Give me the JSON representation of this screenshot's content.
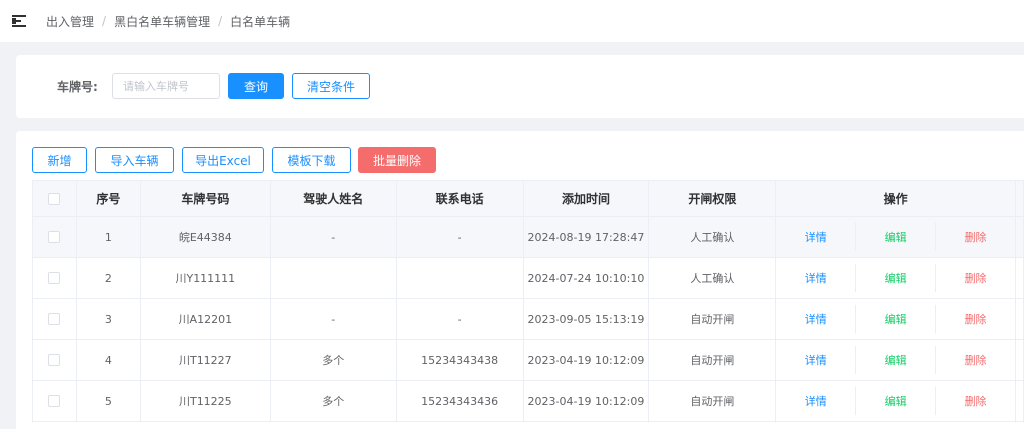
{
  "breadcrumb": [
    "出入管理",
    "黑白名单车辆管理",
    "白名单车辆"
  ],
  "search": {
    "label": "车牌号:",
    "placeholder": "请输入车牌号",
    "query_button": "查询",
    "clear_button": "清空条件"
  },
  "toolbar": {
    "add": "新增",
    "import": "导入车辆",
    "export": "导出Excel",
    "template": "模板下载",
    "batch_delete": "批量删除"
  },
  "table": {
    "columns": [
      "序号",
      "车牌号码",
      "驾驶人姓名",
      "联系电话",
      "添加时间",
      "开闸权限",
      "操作"
    ],
    "rows": [
      {
        "idx": "1",
        "plate": "皖E44384",
        "driver": "-",
        "phone": "-",
        "time": "2024-08-19 17:28:47",
        "perm": "人工确认"
      },
      {
        "idx": "2",
        "plate": "川Y111111",
        "driver": "",
        "phone": "",
        "time": "2024-07-24 10:10:10",
        "perm": "人工确认"
      },
      {
        "idx": "3",
        "plate": "川A12201",
        "driver": "-",
        "phone": "-",
        "time": "2023-09-05 15:13:19",
        "perm": "自动开闸"
      },
      {
        "idx": "4",
        "plate": "川T11227",
        "driver": "多个",
        "phone": "15234343438",
        "time": "2023-04-19 10:12:09",
        "perm": "自动开闸"
      },
      {
        "idx": "5",
        "plate": "川T11225",
        "driver": "多个",
        "phone": "15234343436",
        "time": "2023-04-19 10:12:09",
        "perm": "自动开闸"
      }
    ],
    "actions": {
      "detail": "详情",
      "edit": "编辑",
      "delete": "删除"
    }
  },
  "colors": {
    "primary": "#1890ff",
    "danger": "#f56c6c",
    "success": "#13ce66"
  }
}
